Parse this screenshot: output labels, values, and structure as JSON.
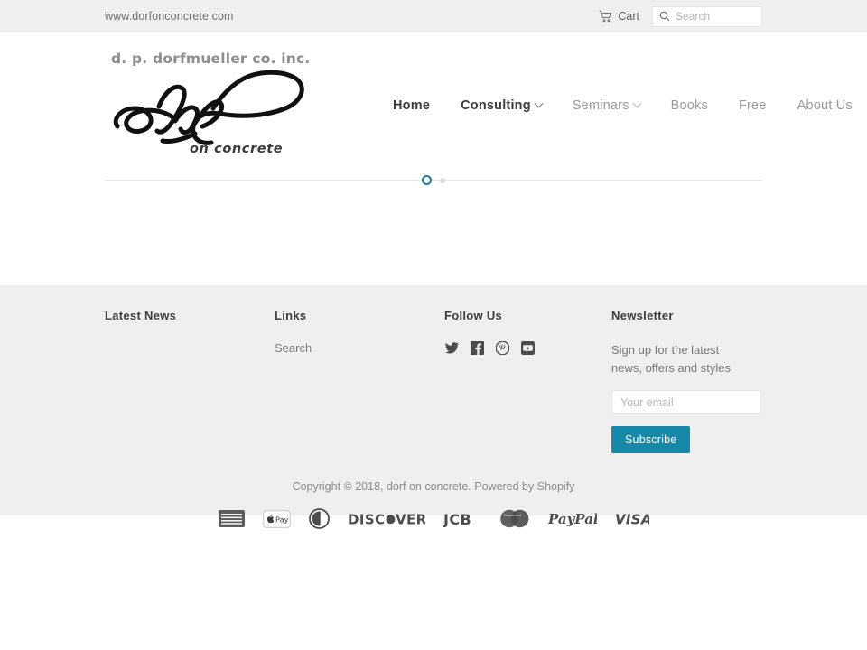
{
  "topbar": {
    "site_url": "www.dorfonconcrete.com",
    "cart_label": "Cart",
    "cart_icon": "shopping-cart-icon",
    "search_icon": "search-icon",
    "search_placeholder": "Search",
    "search_value": ""
  },
  "header": {
    "logo": {
      "top_text": "d. p. dorfmueller co. inc.",
      "script_text": "dorf",
      "bottom_text": "on concrete"
    },
    "nav": [
      {
        "label": "Home",
        "has_caret": false,
        "active": true
      },
      {
        "label": "Consulting",
        "has_caret": true,
        "active": true
      },
      {
        "label": "Seminars",
        "has_caret": true,
        "active": false
      },
      {
        "label": "Books",
        "has_caret": false,
        "active": false
      },
      {
        "label": "Free",
        "has_caret": false,
        "active": false
      },
      {
        "label": "About Us",
        "has_caret": false,
        "active": false
      }
    ]
  },
  "slideshow": {
    "dots": [
      {
        "name": "slide-dot-1",
        "active": true
      },
      {
        "name": "slide-dot-2",
        "active": false
      }
    ],
    "active_color": "#1a7f96",
    "inactive_color": "#dcdcdc"
  },
  "footer": {
    "latest_news": {
      "title": "Latest News",
      "items": []
    },
    "links": {
      "title": "Links",
      "items": [
        {
          "label": "Search"
        }
      ]
    },
    "follow_us": {
      "title": "Follow Us",
      "socials": [
        {
          "name": "twitter-icon",
          "label": "Twitter"
        },
        {
          "name": "facebook-icon",
          "label": "Facebook"
        },
        {
          "name": "pinterest-icon",
          "label": "Pinterest"
        },
        {
          "name": "youtube-icon",
          "label": "YouTube"
        }
      ]
    },
    "newsletter": {
      "title": "Newsletter",
      "description": "Sign up for the latest news, offers and styles",
      "email_placeholder": "Your email",
      "email_value": "",
      "subscribe_label": "Subscribe",
      "subscribe_color": "#1689a8"
    },
    "copyright": "Copyright © 2018, dorf on concrete. Powered by Shopify",
    "payments": [
      {
        "name": "american-express-icon",
        "label": "American Express"
      },
      {
        "name": "apple-pay-icon",
        "label": "Apple Pay"
      },
      {
        "name": "diners-club-icon",
        "label": "Diners Club"
      },
      {
        "name": "discover-icon",
        "label": "DISCOVER"
      },
      {
        "name": "jcb-icon",
        "label": "JCB"
      },
      {
        "name": "mastercard-icon",
        "label": "Mastercard"
      },
      {
        "name": "paypal-icon",
        "label": "PayPal"
      },
      {
        "name": "visa-icon",
        "label": "VISA"
      }
    ]
  },
  "colors": {
    "bar_bg": "#efefef",
    "footer_bg": "#efefef",
    "page_bg": "#ffffff",
    "accent": "#1689a8",
    "text_dark": "#3d3d3d",
    "text_muted": "#8a8a8a"
  }
}
